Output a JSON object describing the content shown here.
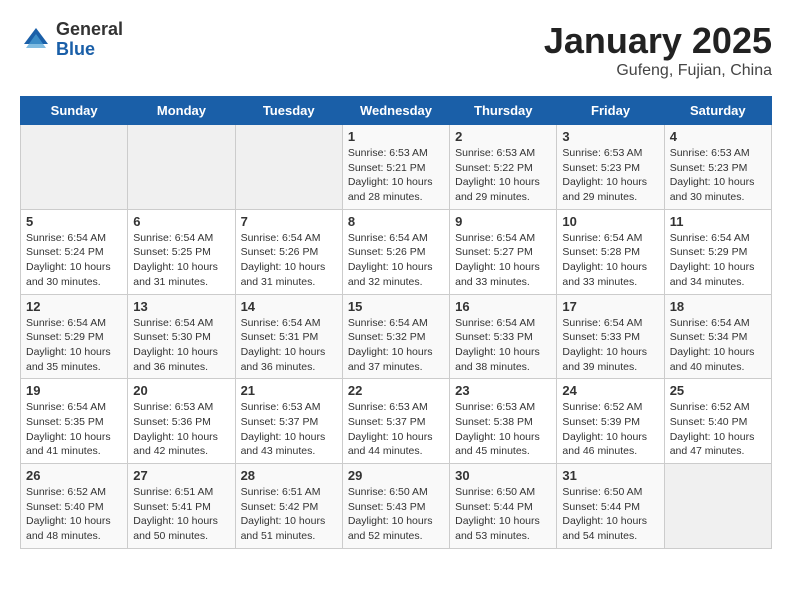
{
  "logo": {
    "general": "General",
    "blue": "Blue"
  },
  "title": "January 2025",
  "subtitle": "Gufeng, Fujian, China",
  "weekdays": [
    "Sunday",
    "Monday",
    "Tuesday",
    "Wednesday",
    "Thursday",
    "Friday",
    "Saturday"
  ],
  "weeks": [
    [
      {
        "day": "",
        "info": ""
      },
      {
        "day": "",
        "info": ""
      },
      {
        "day": "",
        "info": ""
      },
      {
        "day": "1",
        "info": "Sunrise: 6:53 AM\nSunset: 5:21 PM\nDaylight: 10 hours\nand 28 minutes."
      },
      {
        "day": "2",
        "info": "Sunrise: 6:53 AM\nSunset: 5:22 PM\nDaylight: 10 hours\nand 29 minutes."
      },
      {
        "day": "3",
        "info": "Sunrise: 6:53 AM\nSunset: 5:23 PM\nDaylight: 10 hours\nand 29 minutes."
      },
      {
        "day": "4",
        "info": "Sunrise: 6:53 AM\nSunset: 5:23 PM\nDaylight: 10 hours\nand 30 minutes."
      }
    ],
    [
      {
        "day": "5",
        "info": "Sunrise: 6:54 AM\nSunset: 5:24 PM\nDaylight: 10 hours\nand 30 minutes."
      },
      {
        "day": "6",
        "info": "Sunrise: 6:54 AM\nSunset: 5:25 PM\nDaylight: 10 hours\nand 31 minutes."
      },
      {
        "day": "7",
        "info": "Sunrise: 6:54 AM\nSunset: 5:26 PM\nDaylight: 10 hours\nand 31 minutes."
      },
      {
        "day": "8",
        "info": "Sunrise: 6:54 AM\nSunset: 5:26 PM\nDaylight: 10 hours\nand 32 minutes."
      },
      {
        "day": "9",
        "info": "Sunrise: 6:54 AM\nSunset: 5:27 PM\nDaylight: 10 hours\nand 33 minutes."
      },
      {
        "day": "10",
        "info": "Sunrise: 6:54 AM\nSunset: 5:28 PM\nDaylight: 10 hours\nand 33 minutes."
      },
      {
        "day": "11",
        "info": "Sunrise: 6:54 AM\nSunset: 5:29 PM\nDaylight: 10 hours\nand 34 minutes."
      }
    ],
    [
      {
        "day": "12",
        "info": "Sunrise: 6:54 AM\nSunset: 5:29 PM\nDaylight: 10 hours\nand 35 minutes."
      },
      {
        "day": "13",
        "info": "Sunrise: 6:54 AM\nSunset: 5:30 PM\nDaylight: 10 hours\nand 36 minutes."
      },
      {
        "day": "14",
        "info": "Sunrise: 6:54 AM\nSunset: 5:31 PM\nDaylight: 10 hours\nand 36 minutes."
      },
      {
        "day": "15",
        "info": "Sunrise: 6:54 AM\nSunset: 5:32 PM\nDaylight: 10 hours\nand 37 minutes."
      },
      {
        "day": "16",
        "info": "Sunrise: 6:54 AM\nSunset: 5:33 PM\nDaylight: 10 hours\nand 38 minutes."
      },
      {
        "day": "17",
        "info": "Sunrise: 6:54 AM\nSunset: 5:33 PM\nDaylight: 10 hours\nand 39 minutes."
      },
      {
        "day": "18",
        "info": "Sunrise: 6:54 AM\nSunset: 5:34 PM\nDaylight: 10 hours\nand 40 minutes."
      }
    ],
    [
      {
        "day": "19",
        "info": "Sunrise: 6:54 AM\nSunset: 5:35 PM\nDaylight: 10 hours\nand 41 minutes."
      },
      {
        "day": "20",
        "info": "Sunrise: 6:53 AM\nSunset: 5:36 PM\nDaylight: 10 hours\nand 42 minutes."
      },
      {
        "day": "21",
        "info": "Sunrise: 6:53 AM\nSunset: 5:37 PM\nDaylight: 10 hours\nand 43 minutes."
      },
      {
        "day": "22",
        "info": "Sunrise: 6:53 AM\nSunset: 5:37 PM\nDaylight: 10 hours\nand 44 minutes."
      },
      {
        "day": "23",
        "info": "Sunrise: 6:53 AM\nSunset: 5:38 PM\nDaylight: 10 hours\nand 45 minutes."
      },
      {
        "day": "24",
        "info": "Sunrise: 6:52 AM\nSunset: 5:39 PM\nDaylight: 10 hours\nand 46 minutes."
      },
      {
        "day": "25",
        "info": "Sunrise: 6:52 AM\nSunset: 5:40 PM\nDaylight: 10 hours\nand 47 minutes."
      }
    ],
    [
      {
        "day": "26",
        "info": "Sunrise: 6:52 AM\nSunset: 5:40 PM\nDaylight: 10 hours\nand 48 minutes."
      },
      {
        "day": "27",
        "info": "Sunrise: 6:51 AM\nSunset: 5:41 PM\nDaylight: 10 hours\nand 50 minutes."
      },
      {
        "day": "28",
        "info": "Sunrise: 6:51 AM\nSunset: 5:42 PM\nDaylight: 10 hours\nand 51 minutes."
      },
      {
        "day": "29",
        "info": "Sunrise: 6:50 AM\nSunset: 5:43 PM\nDaylight: 10 hours\nand 52 minutes."
      },
      {
        "day": "30",
        "info": "Sunrise: 6:50 AM\nSunset: 5:44 PM\nDaylight: 10 hours\nand 53 minutes."
      },
      {
        "day": "31",
        "info": "Sunrise: 6:50 AM\nSunset: 5:44 PM\nDaylight: 10 hours\nand 54 minutes."
      },
      {
        "day": "",
        "info": ""
      }
    ]
  ]
}
